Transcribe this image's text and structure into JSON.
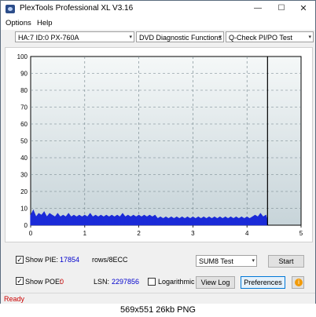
{
  "window": {
    "title": "PlexTools Professional XL V3.16",
    "min_glyph": "—",
    "max_glyph": "☐",
    "close_glyph": "✕"
  },
  "menu": {
    "options": "Options",
    "help": "Help"
  },
  "toolbar": {
    "drive": "HA:7 ID:0  PX-760A",
    "function": "DVD Diagnostic Functions",
    "test": "Q-Check PI/PO Test",
    "arrow": "▾"
  },
  "chart_data": {
    "type": "area",
    "x_ticks": [
      "0",
      "1",
      "2",
      "3",
      "4",
      "5"
    ],
    "y_ticks": [
      "100",
      "90",
      "80",
      "70",
      "60",
      "50",
      "40",
      "30",
      "20",
      "10",
      "0"
    ],
    "xlim": [
      0,
      5
    ],
    "ylim": [
      0,
      100
    ],
    "end_marker_x": 4.38,
    "grid": true,
    "colors": {
      "pie": "#1a2bd8",
      "background_top": "#f5f8f8",
      "background_bottom": "#c7d4d9",
      "grid": "#6d7f86"
    },
    "series": [
      {
        "values": [
          [
            0.0,
            6
          ],
          [
            0.05,
            9
          ],
          [
            0.1,
            5
          ],
          [
            0.15,
            7
          ],
          [
            0.2,
            6
          ],
          [
            0.25,
            8
          ],
          [
            0.3,
            5
          ],
          [
            0.35,
            7
          ],
          [
            0.4,
            6
          ],
          [
            0.45,
            5
          ],
          [
            0.5,
            7
          ],
          [
            0.55,
            5
          ],
          [
            0.6,
            6
          ],
          [
            0.65,
            5
          ],
          [
            0.7,
            7
          ],
          [
            0.75,
            5
          ],
          [
            0.8,
            6
          ],
          [
            0.85,
            5
          ],
          [
            0.9,
            6
          ],
          [
            0.95,
            5
          ],
          [
            1.0,
            6
          ],
          [
            1.05,
            5
          ],
          [
            1.1,
            7
          ],
          [
            1.15,
            5
          ],
          [
            1.2,
            6
          ],
          [
            1.25,
            5
          ],
          [
            1.3,
            6
          ],
          [
            1.35,
            5
          ],
          [
            1.4,
            6
          ],
          [
            1.45,
            5
          ],
          [
            1.5,
            6
          ],
          [
            1.55,
            5
          ],
          [
            1.6,
            6
          ],
          [
            1.65,
            5
          ],
          [
            1.7,
            7
          ],
          [
            1.75,
            5
          ],
          [
            1.8,
            6
          ],
          [
            1.85,
            5
          ],
          [
            1.9,
            6
          ],
          [
            1.95,
            5
          ],
          [
            2.0,
            6
          ],
          [
            2.05,
            5
          ],
          [
            2.1,
            6
          ],
          [
            2.15,
            5
          ],
          [
            2.2,
            6
          ],
          [
            2.25,
            5
          ],
          [
            2.3,
            6
          ],
          [
            2.35,
            4
          ],
          [
            2.4,
            5
          ],
          [
            2.45,
            4
          ],
          [
            2.5,
            5
          ],
          [
            2.55,
            4
          ],
          [
            2.6,
            5
          ],
          [
            2.65,
            4
          ],
          [
            2.7,
            5
          ],
          [
            2.75,
            4
          ],
          [
            2.8,
            5
          ],
          [
            2.85,
            4
          ],
          [
            2.9,
            5
          ],
          [
            2.95,
            4
          ],
          [
            3.0,
            5
          ],
          [
            3.05,
            4
          ],
          [
            3.1,
            5
          ],
          [
            3.15,
            4
          ],
          [
            3.2,
            5
          ],
          [
            3.25,
            4
          ],
          [
            3.3,
            5
          ],
          [
            3.35,
            4
          ],
          [
            3.4,
            5
          ],
          [
            3.45,
            4
          ],
          [
            3.5,
            5
          ],
          [
            3.55,
            4
          ],
          [
            3.6,
            5
          ],
          [
            3.65,
            4
          ],
          [
            3.7,
            5
          ],
          [
            3.75,
            4
          ],
          [
            3.8,
            5
          ],
          [
            3.85,
            4
          ],
          [
            3.9,
            5
          ],
          [
            3.95,
            4
          ],
          [
            4.0,
            5
          ],
          [
            4.05,
            4
          ],
          [
            4.1,
            5
          ],
          [
            4.15,
            6
          ],
          [
            4.2,
            5
          ],
          [
            4.25,
            7
          ],
          [
            4.3,
            5
          ],
          [
            4.35,
            6
          ],
          [
            4.38,
            3
          ]
        ]
      }
    ]
  },
  "controls": {
    "show_pie_label": "Show PIE:",
    "show_pie_value": "17854",
    "show_pie_checked": "✓",
    "rows_label": "rows/8ECC",
    "sum_select": "SUM8 Test",
    "start_label": "Start",
    "show_poe_label": "Show POE:",
    "show_poe_value": "0",
    "show_poe_checked": "✓",
    "lsn_label": "LSN:",
    "lsn_value": "2297856",
    "log_label": "Logarithmic",
    "view_log_label": "View Log",
    "preferences_label": "Preferences",
    "info_glyph": "i",
    "accent_value_color": "#0000cc",
    "poe_value_color": "#cc0000"
  },
  "status": {
    "text": "Ready"
  },
  "caption": {
    "text": "569x551  26kb  PNG"
  }
}
